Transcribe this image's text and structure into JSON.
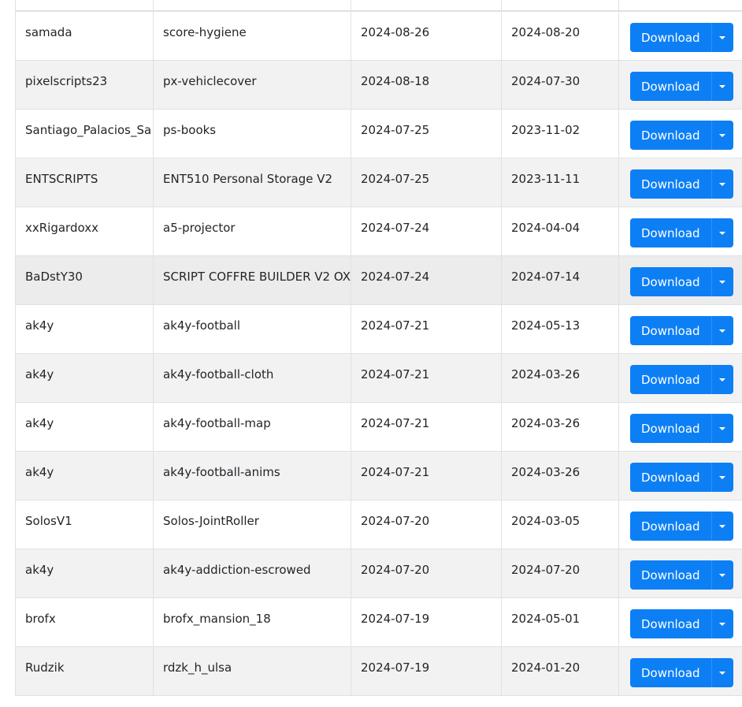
{
  "button_label": "Download",
  "rows": [
    {
      "author": "samada",
      "name": "score-hygiene",
      "updated": "2024-08-26",
      "created": "2024-08-20"
    },
    {
      "author": "pixelscripts23",
      "name": "px-vehiclecover",
      "updated": "2024-08-18",
      "created": "2024-07-30"
    },
    {
      "author": "Santiago_Palacios_Sa",
      "name": "ps-books",
      "updated": "2024-07-25",
      "created": "2023-11-02"
    },
    {
      "author": "ENTSCRIPTS",
      "name": "ENT510 Personal Storage V2",
      "updated": "2024-07-25",
      "created": "2023-11-11"
    },
    {
      "author": "xxRigardoxx",
      "name": "a5-projector",
      "updated": "2024-07-24",
      "created": "2024-04-04"
    },
    {
      "author": "BaDstY30",
      "name": "SCRIPT COFFRE BUILDER V2 OX",
      "updated": "2024-07-24",
      "created": "2024-07-14"
    },
    {
      "author": "ak4y",
      "name": "ak4y-football",
      "updated": "2024-07-21",
      "created": "2024-05-13"
    },
    {
      "author": "ak4y",
      "name": "ak4y-football-cloth",
      "updated": "2024-07-21",
      "created": "2024-03-26"
    },
    {
      "author": "ak4y",
      "name": "ak4y-football-map",
      "updated": "2024-07-21",
      "created": "2024-03-26"
    },
    {
      "author": "ak4y",
      "name": "ak4y-football-anims",
      "updated": "2024-07-21",
      "created": "2024-03-26"
    },
    {
      "author": "SolosV1",
      "name": "Solos-JointRoller",
      "updated": "2024-07-20",
      "created": "2024-03-05"
    },
    {
      "author": "ak4y",
      "name": "ak4y-addiction-escrowed",
      "updated": "2024-07-20",
      "created": "2024-07-20"
    },
    {
      "author": "brofx",
      "name": "brofx_mansion_18",
      "updated": "2024-07-19",
      "created": "2024-05-01"
    },
    {
      "author": "Rudzik",
      "name": "rdzk_h_ulsa",
      "updated": "2024-07-19",
      "created": "2024-01-20"
    }
  ]
}
